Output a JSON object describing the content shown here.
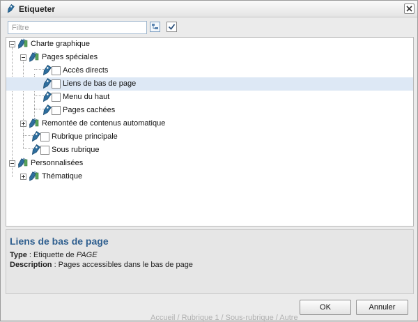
{
  "window": {
    "title": "Etiqueter"
  },
  "filter": {
    "placeholder": "Filtre",
    "value": ""
  },
  "tree": {
    "root1": "Charte graphique",
    "pages_speciales": "Pages spéciales",
    "acces_directs": "Accès directs",
    "liens_bas_page": "Liens de bas de page",
    "menu_haut": "Menu du haut",
    "pages_cachees": "Pages cachées",
    "remontee": "Remontée de contenus automatique",
    "rubrique_principale": "Rubrique principale",
    "sous_rubrique": "Sous rubrique",
    "root2": "Personnalisées",
    "thematique": "Thématique"
  },
  "details": {
    "title": "Liens de bas de page",
    "type_label": "Type",
    "type_prefix": " : Etiquette de ",
    "type_value": "PAGE",
    "description_label": "Description",
    "description_value": " : Pages accessibles dans le bas de page"
  },
  "buttons": {
    "ok": "OK",
    "cancel": "Annuler"
  },
  "background": {
    "breadcrumb": "Accueil / Rubrique 1 / Sous-rubrique / Autre"
  },
  "colors": {
    "selection": "#dde8f5",
    "details_title": "#2f5f8f",
    "tag_icon": "#2e6e9e"
  },
  "icons": {
    "title": "tag-icon",
    "close": "close-icon",
    "expand_all": "expand-all-icon",
    "check_all": "checkmark-icon",
    "folder": "tag-folder-icon",
    "leaf": "tag-icon"
  }
}
